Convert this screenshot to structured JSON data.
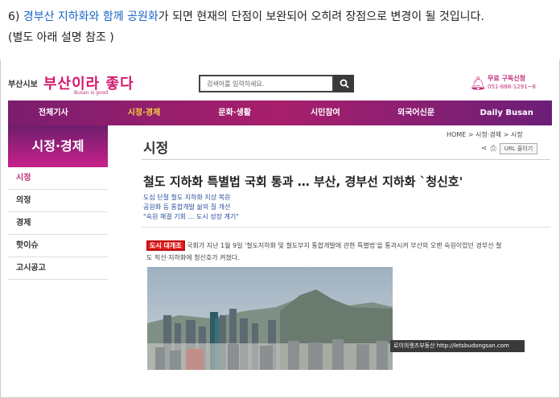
{
  "caption": {
    "prefix": "6) ",
    "blue1": "경부산 지하화와 함께 공원화",
    "line1_rest": "가 되면 현재의 단점이 보완되어 오히려 장점으로 변경이 될 것입니다.",
    "line2": "(별도 아래 설명 참조 )"
  },
  "header": {
    "brand_small": "부산시보",
    "brand_big": "부산이라 좋다",
    "brand_tag": "Busan is good",
    "search_placeholder": "검색어를 입력하세요.",
    "subscribe_label": "무료 구독신청",
    "subscribe_phone": "051-888-1291~8"
  },
  "nav": [
    {
      "label": "전체기사",
      "active": false
    },
    {
      "label": "시정·경제",
      "active": true
    },
    {
      "label": "문화·생활",
      "active": false
    },
    {
      "label": "시민참여",
      "active": false
    },
    {
      "label": "외국어신문",
      "active": false
    },
    {
      "label": "Daily Busan",
      "active": false
    }
  ],
  "sidebar": {
    "title": "시정·경제",
    "items": [
      {
        "label": "시정",
        "active": true
      },
      {
        "label": "의정",
        "active": false
      },
      {
        "label": "경제",
        "active": false
      },
      {
        "label": "핫이슈",
        "active": false
      },
      {
        "label": "고시공고",
        "active": false
      }
    ]
  },
  "main": {
    "section_title": "시정",
    "breadcrumb": "HOME > 시정·경제 > 시정",
    "url_button": "URL 줄이기",
    "headline": "철도 지하화 특별법 국회 통과 … 부산, 경부선 지하화 `청신호'",
    "subheads": [
      "도심 단절 철도 지하화 지상 복원",
      "공원화 등 통합개발 삶의 질 개선",
      "\"숙원 해결 기회 … 도시 성장 계기\""
    ],
    "body_highlight": "도시 대개조",
    "body_line1": " 국회가 지난 1월 9일 '철도지하화 및 철도부지 통합개발에 관한 특별법'을 통과시켜 부산의 오랜 숙원이었던 경부선 철",
    "body_line2": "도 직선·지하화에 청신호가 켜졌다.",
    "photo_watermark": "로이의렛츠부동산 http://letsbudongsan.com"
  }
}
